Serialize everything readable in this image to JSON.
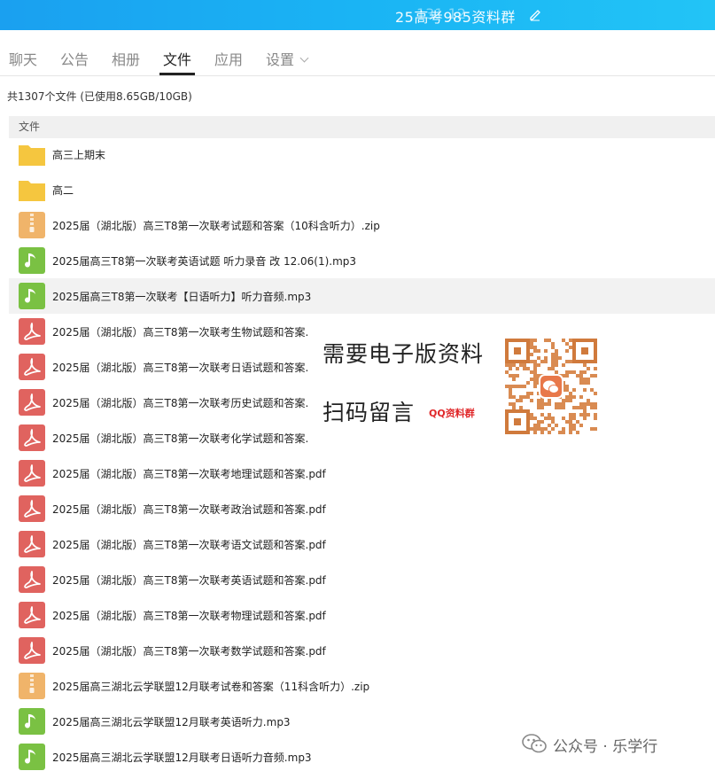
{
  "titlebar": {
    "title": "25高考985资料群",
    "title_overlay": "131 12"
  },
  "tabs": [
    {
      "label": "聊天"
    },
    {
      "label": "公告"
    },
    {
      "label": "相册"
    },
    {
      "label": "文件",
      "active": true
    },
    {
      "label": "应用"
    },
    {
      "label": "设置"
    }
  ],
  "summary": "共1307个文件 (已使用8.65GB/10GB)",
  "list_header": "文件",
  "files": [
    {
      "type": "folder",
      "name": "高三上期末"
    },
    {
      "type": "folder",
      "name": "高二"
    },
    {
      "type": "zip",
      "name": "2025届（湖北版）高三T8第一次联考试题和答案（10科含听力）.zip"
    },
    {
      "type": "mp3",
      "name": "2025届高三T8第一次联考英语试题 听力录音 改 12.06(1).mp3"
    },
    {
      "type": "mp3",
      "name": "2025届高三T8第一次联考【日语听力】听力音频.mp3",
      "selected": true
    },
    {
      "type": "pdf",
      "name": "2025届（湖北版）高三T8第一次联考生物试题和答案."
    },
    {
      "type": "pdf",
      "name": "2025届（湖北版）高三T8第一次联考日语试题和答案."
    },
    {
      "type": "pdf",
      "name": "2025届（湖北版）高三T8第一次联考历史试题和答案."
    },
    {
      "type": "pdf",
      "name": "2025届（湖北版）高三T8第一次联考化学试题和答案."
    },
    {
      "type": "pdf",
      "name": "2025届（湖北版）高三T8第一次联考地理试题和答案.pdf"
    },
    {
      "type": "pdf",
      "name": "2025届（湖北版）高三T8第一次联考政治试题和答案.pdf"
    },
    {
      "type": "pdf",
      "name": "2025届（湖北版）高三T8第一次联考语文试题和答案.pdf"
    },
    {
      "type": "pdf",
      "name": "2025届（湖北版）高三T8第一次联考英语试题和答案.pdf"
    },
    {
      "type": "pdf",
      "name": "2025届（湖北版）高三T8第一次联考物理试题和答案.pdf"
    },
    {
      "type": "pdf",
      "name": "2025届（湖北版）高三T8第一次联考数学试题和答案.pdf"
    },
    {
      "type": "zip",
      "name": "2025届高三湖北云学联盟12月联考试卷和答案（11科含听力）.zip"
    },
    {
      "type": "mp3",
      "name": "2025届高三湖北云学联盟12月联考英语听力.mp3"
    },
    {
      "type": "mp3",
      "name": "2025届高三湖北云学联盟12月联考日语听力音频.mp3"
    }
  ],
  "ad": {
    "line1": "需要电子版资料",
    "line2": "扫码留言",
    "tag": "QQ资料群"
  },
  "watermark": "公众号 · 乐学行",
  "colors": {
    "titlebar": "#1ab4f4",
    "folder": "#f5c640",
    "zip": "#f0b46a",
    "mp3": "#7ac143",
    "pdf": "#e0635f"
  }
}
